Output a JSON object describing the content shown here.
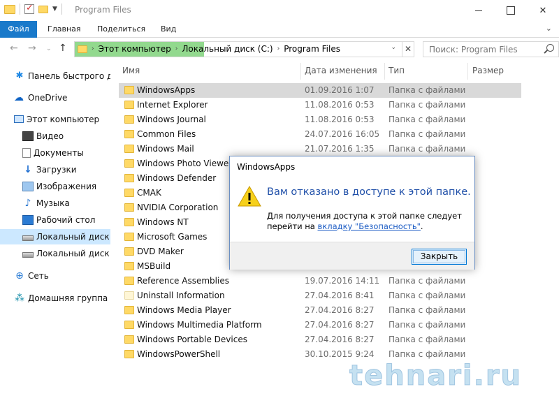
{
  "window": {
    "title": "Program Files"
  },
  "ribbon": {
    "tabs": [
      "Файл",
      "Главная",
      "Поделиться",
      "Вид"
    ]
  },
  "address": {
    "crumbs": [
      "Этот компьютер",
      "Локальный диск (C:)",
      "Program Files"
    ]
  },
  "search": {
    "placeholder": "Поиск: Program Files"
  },
  "sidebar": {
    "items": [
      {
        "label": "Панель быстрого доступа",
        "icon": "star-icon"
      },
      {
        "label": "OneDrive",
        "icon": "cloud-icon"
      },
      {
        "label": "Этот компьютер",
        "icon": "computer-icon"
      },
      {
        "label": "Видео",
        "icon": "video-icon"
      },
      {
        "label": "Документы",
        "icon": "document-icon"
      },
      {
        "label": "Загрузки",
        "icon": "download-icon"
      },
      {
        "label": "Изображения",
        "icon": "image-icon"
      },
      {
        "label": "Музыка",
        "icon": "music-icon"
      },
      {
        "label": "Рабочий стол",
        "icon": "desktop-icon"
      },
      {
        "label": "Локальный диск (C:)",
        "icon": "drive-icon"
      },
      {
        "label": "Локальный диск (D:)",
        "icon": "drive-icon"
      },
      {
        "label": "Сеть",
        "icon": "network-icon"
      },
      {
        "label": "Домашняя группа",
        "icon": "homegroup-icon"
      }
    ]
  },
  "columns": [
    "Имя",
    "Дата изменения",
    "Тип",
    "Размер"
  ],
  "files": [
    {
      "name": "WindowsApps",
      "date": "01.09.2016 1:07",
      "type": "Папка с файлами"
    },
    {
      "name": "Internet Explorer",
      "date": "11.08.2016 0:53",
      "type": "Папка с файлами"
    },
    {
      "name": "Windows Journal",
      "date": "11.08.2016 0:53",
      "type": "Папка с файлами"
    },
    {
      "name": "Common Files",
      "date": "24.07.2016 16:05",
      "type": "Папка с файлами"
    },
    {
      "name": "Windows Mail",
      "date": "21.07.2016 1:35",
      "type": "Папка с файлами"
    },
    {
      "name": "Windows Photo Viewer",
      "date": "",
      "type": ""
    },
    {
      "name": "Windows Defender",
      "date": "",
      "type": ""
    },
    {
      "name": "CMAK",
      "date": "",
      "type": ""
    },
    {
      "name": "NVIDIA Corporation",
      "date": "",
      "type": ""
    },
    {
      "name": "Windows NT",
      "date": "",
      "type": ""
    },
    {
      "name": "Microsoft Games",
      "date": "",
      "type": ""
    },
    {
      "name": "DVD Maker",
      "date": "",
      "type": ""
    },
    {
      "name": "MSBuild",
      "date": "",
      "type": ""
    },
    {
      "name": "Reference Assemblies",
      "date": "19.07.2016 14:11",
      "type": "Папка с файлами"
    },
    {
      "name": "Uninstall Information",
      "date": "27.04.2016 8:41",
      "type": "Папка с файлами"
    },
    {
      "name": "Windows Media Player",
      "date": "27.04.2016 8:27",
      "type": "Папка с файлами"
    },
    {
      "name": "Windows Multimedia Platform",
      "date": "27.04.2016 8:27",
      "type": "Папка с файлами"
    },
    {
      "name": "Windows Portable Devices",
      "date": "27.04.2016 8:27",
      "type": "Папка с файлами"
    },
    {
      "name": "WindowsPowerShell",
      "date": "30.10.2015 9:24",
      "type": "Папка с файлами"
    }
  ],
  "dialog": {
    "title": "WindowsApps",
    "message": "Вам отказано в доступе к этой папке.",
    "detail_prefix": "Для получения доступа к этой папке следует перейти на ",
    "detail_link": "вкладку \"Безопасность\"",
    "detail_suffix": ".",
    "close_label": "Закрыть"
  },
  "watermark": "tehnari.ru",
  "colors": {
    "accent": "#1979ca",
    "selection": "#cce8ff",
    "address_highlight": "#7fd27a",
    "folder": "#ffd966"
  }
}
